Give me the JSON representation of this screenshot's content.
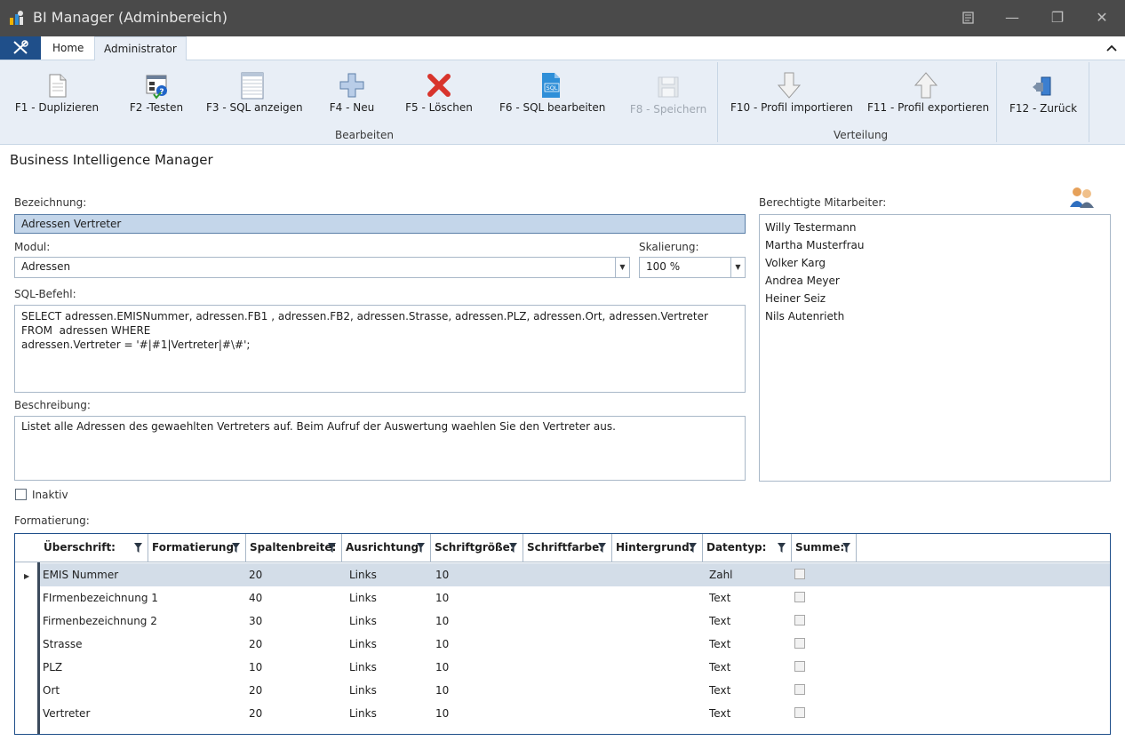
{
  "window": {
    "title": "BI Manager (Adminbereich)",
    "controls": {
      "menu": "menu-icon",
      "minimize": "—",
      "maximize": "❐",
      "close": "✕"
    }
  },
  "tabs": {
    "tools_icon": "tools-icon",
    "home": "Home",
    "admin": "Administrator"
  },
  "ribbon": {
    "duplicate": "F1 - Duplizieren",
    "test": "F2 -Testen",
    "show_sql": "F3 - SQL anzeigen",
    "new": "F4 - Neu",
    "delete": "F5 - Löschen",
    "edit_sql": "F6 - SQL bearbeiten",
    "save": "F8 - Speichern",
    "import": "F10 - Profil importieren",
    "export": "F11 - Profil exportieren",
    "back": "F12 - Zurück",
    "group_edit": "Bearbeiten",
    "group_distribution": "Verteilung"
  },
  "main": {
    "title": "Business Intelligence Manager",
    "name_label": "Bezeichnung:",
    "name_value": "Adressen Vertreter",
    "module_label": "Modul:",
    "module_value": "Adressen",
    "scale_label": "Skalierung:",
    "scale_value": "100 %",
    "sql_label": "SQL-Befehl:",
    "sql_value": "SELECT adressen.EMISNummer, adressen.FB1 , adressen.FB2, adressen.Strasse, adressen.PLZ, adressen.Ort, adressen.Vertreter FROM  adressen WHERE\nadressen.Vertreter = '#|#1|Vertreter|#\\#';",
    "desc_label": "Beschreibung:",
    "desc_value": "Listet alle Adressen des gewaehlten Vertreters auf. Beim Aufruf der Auswertung waehlen Sie den Vertreter aus.",
    "inactive_label": "Inaktiv",
    "format_label": "Formatierung:"
  },
  "staff": {
    "label": "Berechtigte Mitarbeiter:",
    "items": [
      "Willy Testermann",
      "Martha Musterfrau",
      "Volker Karg",
      "Andrea Meyer",
      "Heiner Seiz",
      "Nils Autenrieth"
    ]
  },
  "grid": {
    "columns": [
      "Überschrift:",
      "Formatierung:",
      "Spaltenbreite:",
      "Ausrichtung:",
      "Schriftgröße:",
      "Schriftfarbe:",
      "Hintergrund:",
      "Datentyp:",
      "Summe:"
    ],
    "rows": [
      {
        "heading": "EMIS Nummer",
        "format": "",
        "width": "20",
        "align": "Links",
        "size": "10",
        "color": "",
        "bg": "",
        "type": "Zahl"
      },
      {
        "heading": "FIrmenbezeichnung 1",
        "format": "",
        "width": "40",
        "align": "Links",
        "size": "10",
        "color": "",
        "bg": "",
        "type": "Text"
      },
      {
        "heading": "Firmenbezeichnung 2",
        "format": "",
        "width": "30",
        "align": "Links",
        "size": "10",
        "color": "",
        "bg": "",
        "type": "Text"
      },
      {
        "heading": "Strasse",
        "format": "",
        "width": "20",
        "align": "Links",
        "size": "10",
        "color": "",
        "bg": "",
        "type": "Text"
      },
      {
        "heading": "PLZ",
        "format": "",
        "width": "10",
        "align": "Links",
        "size": "10",
        "color": "",
        "bg": "",
        "type": "Text"
      },
      {
        "heading": "Ort",
        "format": "",
        "width": "20",
        "align": "Links",
        "size": "10",
        "color": "",
        "bg": "",
        "type": "Text"
      },
      {
        "heading": "Vertreter",
        "format": "",
        "width": "20",
        "align": "Links",
        "size": "10",
        "color": "",
        "bg": "",
        "type": "Text"
      }
    ]
  }
}
